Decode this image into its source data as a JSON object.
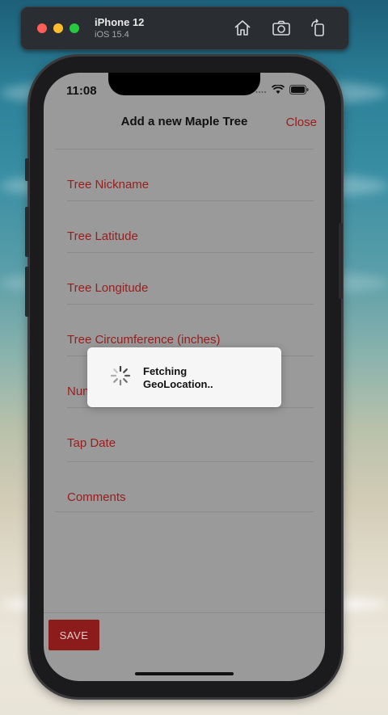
{
  "simulator": {
    "device_name": "iPhone 12",
    "os_version": "iOS 15.4",
    "toolbar_icons": [
      "home-icon",
      "screenshot-icon",
      "rotate-icon"
    ]
  },
  "status_bar": {
    "time": "11:08"
  },
  "nav": {
    "title": "Add a new Maple Tree",
    "close_label": "Close"
  },
  "form": {
    "fields": [
      {
        "label": "Tree Nickname"
      },
      {
        "label": "Tree Latitude"
      },
      {
        "label": "Tree Longitude"
      },
      {
        "label": "Tree Circumference (inches)"
      },
      {
        "label": "Num"
      },
      {
        "label": "Tap Date"
      },
      {
        "label": "Comments"
      }
    ]
  },
  "save_button": {
    "label": "SAVE"
  },
  "loading_dialog": {
    "line1": "Fetching",
    "line2": "GeoLocation.."
  },
  "colors": {
    "accent": "#9b1c1c",
    "save_button_bg": "#8c1c1c",
    "screen_bg": "#9a9a9a"
  }
}
